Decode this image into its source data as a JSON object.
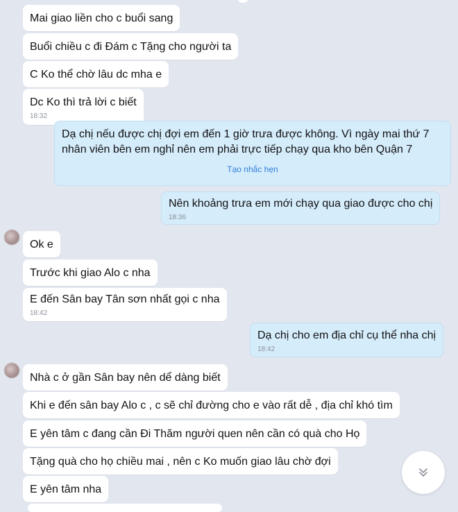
{
  "conversation": {
    "messages": [
      {
        "text": "Mai giao liền cho c buổi sang",
        "time": ""
      },
      {
        "text": "Buổi chiều c đi Đám c Tặng cho người ta",
        "time": ""
      },
      {
        "text": "C Ko thể chờ lâu dc mha e",
        "time": ""
      },
      {
        "text": "Dc Ko thì trả lời c biết",
        "time": "18:32"
      },
      {
        "line1": "Dạ chị nếu được chị đợi em đến 1 giờ trưa được không. Vì ngày mai thứ 7",
        "line2": "nhân viên bên em nghỉ nên em phải trực tiếp chạy qua kho bên Quận 7",
        "action": "Tạo nhắc hẹn"
      },
      {
        "text": "Nên khoảng trưa em mới chạy qua giao được cho chị",
        "time": "18:36"
      },
      {
        "text": "Ok e",
        "time": ""
      },
      {
        "text": "Trước khi giao Alo c nha",
        "time": ""
      },
      {
        "text": "E đến Sân bay Tân sơn nhất gọi c nha",
        "time": "18:42"
      },
      {
        "text": "Dạ chị cho em địa chỉ cụ thể nha chị",
        "time": "18:42"
      },
      {
        "text": "Nhà c ở gần Sân bay nên dể dàng biết",
        "time": ""
      },
      {
        "text": "Khi e đến sân bay Alo c , c sẽ chỉ đường cho e vào rất dễ , địa chỉ khó tìm",
        "time": ""
      },
      {
        "text": "E yên tâm c đang cần Đi Thăm người quen nên cần có quà cho Họ",
        "time": ""
      },
      {
        "text": "Tặng quà cho họ chiều mai , nên c Ko muốn giao lâu chờ đợi",
        "time": ""
      },
      {
        "text": "E yên tâm nha",
        "time": ""
      }
    ]
  },
  "icons": {
    "scroll_down": "double-chevron-down-icon"
  },
  "colors": {
    "background": "#e2e6ef",
    "incoming": "#ffffff",
    "outgoing": "#d5ecfb",
    "link": "#2f7ed8",
    "timestamp": "#8a8f99"
  }
}
